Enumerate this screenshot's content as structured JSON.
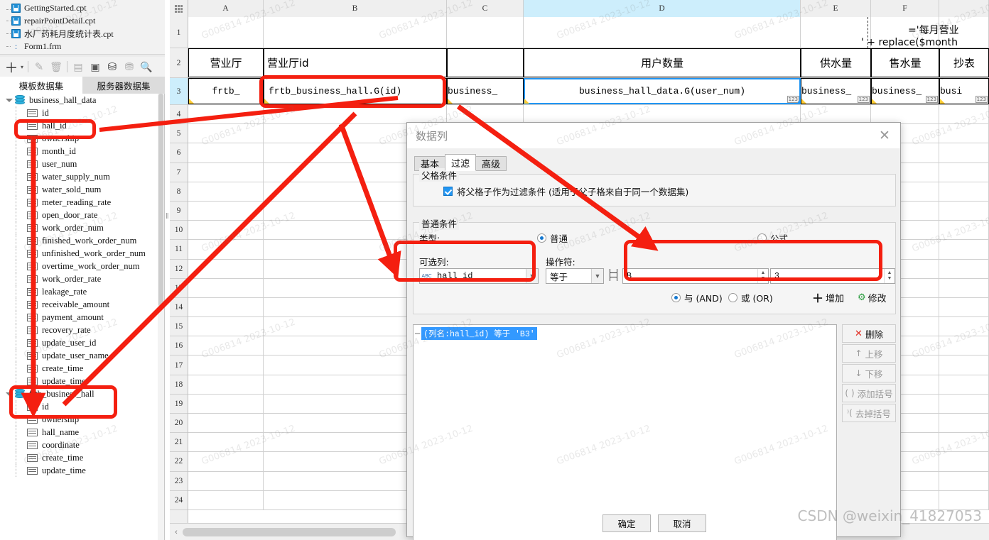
{
  "files": {
    "items": [
      {
        "label": "GettingStarted.cpt",
        "icon": "cpt-file-icon"
      },
      {
        "label": "repairPointDetail.cpt",
        "icon": "cpt-file-icon"
      },
      {
        "label": "水厂药耗月度统计表.cpt",
        "icon": "cpt-file-icon"
      },
      {
        "label": "Form1.frm",
        "icon": "frm-file-icon"
      }
    ]
  },
  "dataset_toolbar": {
    "buttons": [
      {
        "name": "add-dataset-button",
        "glyph": "＋"
      },
      {
        "name": "add-dataset-dropdown",
        "glyph": "▾"
      },
      {
        "name": "edit-dataset-button",
        "glyph": "✎"
      },
      {
        "name": "delete-dataset-button",
        "glyph": "🗑"
      },
      {
        "name": "preview-dataset-button",
        "glyph": "▤"
      },
      {
        "name": "dataset-relation-button",
        "glyph": "▣"
      },
      {
        "name": "server-dataset-button",
        "glyph": "⛁"
      },
      {
        "name": "remove-server-dataset-button",
        "glyph": "⛃"
      },
      {
        "name": "search-dataset-button",
        "glyph": "🔍"
      }
    ]
  },
  "dataset_tabs": [
    {
      "label": "模板数据集",
      "active": true
    },
    {
      "label": "服务器数据集",
      "active": false
    }
  ],
  "tree": [
    {
      "label": "business_hall_data",
      "type": "dataset",
      "children": [
        "id",
        "hall_id",
        "ownership",
        "month_id",
        "user_num",
        "water_supply_num",
        "water_sold_num",
        "meter_reading_rate",
        "open_door_rate",
        "work_order_num",
        "finished_work_order_num",
        "unfinished_work_order_num",
        "overtime_work_order_num",
        "work_order_rate",
        "leakage_rate",
        "receivable_amount",
        "payment_amount",
        "recovery_rate",
        "update_user_id",
        "update_user_name",
        "create_time",
        "update_time"
      ]
    },
    {
      "label": "frtb_business_hall",
      "type": "dataset",
      "children": [
        "id",
        "ownership",
        "hall_name",
        "coordinate",
        "create_time",
        "update_time"
      ]
    }
  ],
  "sheet": {
    "column_headers": [
      "A",
      "B",
      "C",
      "D",
      "E",
      "F"
    ],
    "selected_column": "D",
    "row_headers": [
      "1",
      "2",
      "3",
      "4",
      "5",
      "6",
      "7",
      "8",
      "9",
      "10",
      "11",
      "12",
      "13",
      "14",
      "15",
      "16",
      "17",
      "18",
      "19",
      "20",
      "21",
      "22",
      "23",
      "24"
    ],
    "selected_row": "3",
    "row2": [
      "营业厅",
      "营业厅id",
      "",
      "用户数量",
      "供水量",
      "售水量",
      "抄表"
    ],
    "row3": [
      "frtb_",
      "frtb_business_hall.G(id)",
      "business_",
      "business_hall_data.G(user_num)",
      "business_",
      "business_",
      "busi"
    ],
    "formula_line1": "='每月营业",
    "formula_line2": "' + replace($month"
  },
  "dialog": {
    "title": "数据列",
    "close_glyph": "✕",
    "tabs": [
      {
        "label": "基本",
        "active": false
      },
      {
        "label": "过滤",
        "active": true
      },
      {
        "label": "高级",
        "active": false
      }
    ],
    "parent_group_title": "父格条件",
    "parent_checkbox_label": "将父格子作为过滤条件 (适用于父子格来自于同一个数据集)",
    "parent_checkbox_checked": true,
    "normal_group_title": "普通条件",
    "type_label": "类型:",
    "type_options": [
      {
        "label": "普通",
        "selected": true
      },
      {
        "label": "公式",
        "selected": false
      }
    ],
    "column_label": "可选列:",
    "column_value": "hall_id",
    "operator_label": "操作符:",
    "operator_value": "等于",
    "value_cell_col": "B",
    "value_cell_row": "3",
    "logic_options": [
      {
        "label": "与 (AND)",
        "selected": true
      },
      {
        "label": "或 (OR)",
        "selected": false
      }
    ],
    "add_button": "增加",
    "modify_button": "修改",
    "condition_items": [
      {
        "text": "(列名:hall_id) 等于 'B3'",
        "selected": true
      }
    ],
    "side_buttons": [
      {
        "label": "删除",
        "glyph": "✕",
        "disabled": false
      },
      {
        "label": "上移",
        "glyph": "↑",
        "disabled": true
      },
      {
        "label": "下移",
        "glyph": "↓",
        "disabled": true
      },
      {
        "label": "添加括号",
        "glyph": "( )",
        "disabled": true
      },
      {
        "label": "去掉括号",
        "glyph": "⁾(",
        "disabled": true
      }
    ],
    "ok_button": "确定",
    "cancel_button": "取消"
  },
  "annotations": {
    "watermark": "CSDN @weixin_41827053",
    "tile_watermark": "G006814 2023-10-12",
    "accent_color": "#f41f10"
  }
}
